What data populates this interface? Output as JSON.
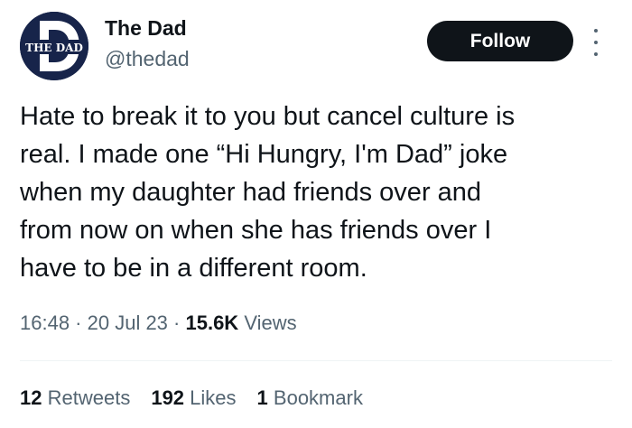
{
  "profile": {
    "display_name": "The Dad",
    "handle": "@thedad",
    "avatar_text": "THE DAD",
    "avatar_color": "#17244a"
  },
  "follow_label": "Follow",
  "tweet": {
    "lines": [
      "Hate to break it to you but cancel culture is",
      "real. I made one “Hi Hungry, I'm Dad” joke",
      "when my daughter had friends over and",
      "from now on when she has friends over I",
      "have to be in a different room."
    ]
  },
  "meta": {
    "time": "16:48",
    "sep1": " · ",
    "date": "20 Jul 23",
    "sep2": " · ",
    "views_count": "15.6K",
    "views_label": "Views"
  },
  "stats": {
    "retweets_count": "12",
    "retweets_label": "Retweets",
    "likes_count": "192",
    "likes_label": "Likes",
    "bookmarks_count": "1",
    "bookmarks_label": "Bookmark"
  },
  "colors": {
    "text_primary": "#0f1419",
    "text_secondary": "#536471",
    "button_bg": "#0f1419",
    "divider": "#eff3f4"
  }
}
